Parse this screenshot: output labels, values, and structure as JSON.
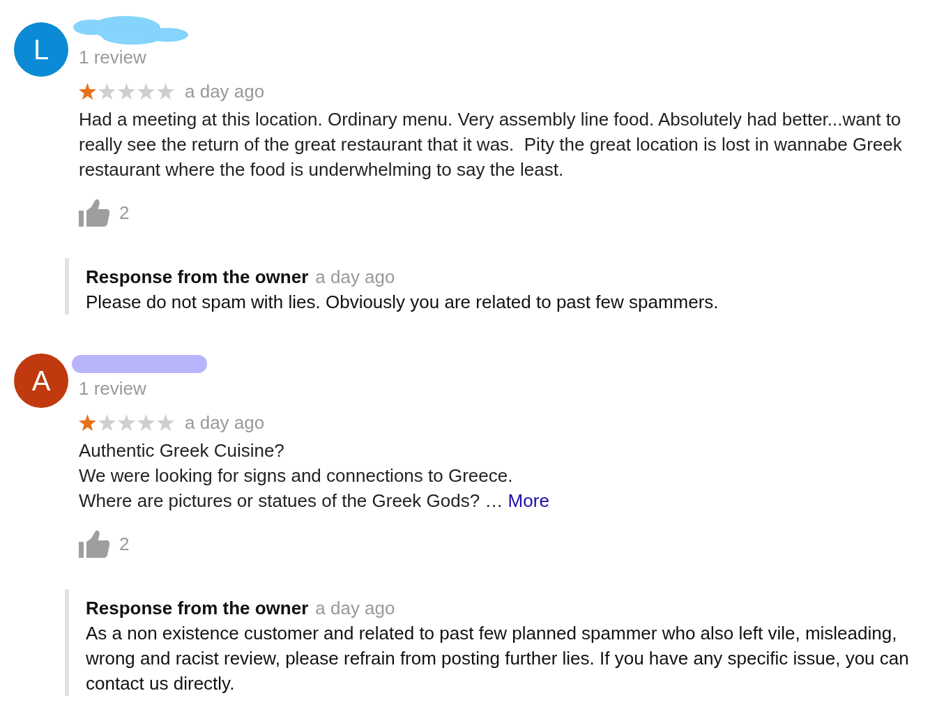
{
  "reviews": [
    {
      "avatar": {
        "letter": "L",
        "color": "#0b8ad6"
      },
      "redaction": {
        "kind": "cloud",
        "color": "#84d4fc"
      },
      "review_count": "1 review",
      "stars": 1,
      "time": "a day ago",
      "text": "Had a meeting at this location. Ordinary menu. Very assembly line food. Absolutely had better...want to really see the return of the great restaurant that it was.  Pity the great location is lost in wannabe Greek restaurant where the food is underwhelming to say the least.",
      "likes": "2",
      "owner_response": {
        "title": "Response from the owner",
        "time": "a day ago",
        "text": "Please do not spam with lies. Obviously you are related to past few spammers."
      }
    },
    {
      "avatar": {
        "letter": "A",
        "color": "#c0390f"
      },
      "redaction": {
        "kind": "stroke",
        "color": "#b8b4fc"
      },
      "review_count": "1 review",
      "stars": 1,
      "time": "a day ago",
      "text": "Authentic Greek Cuisine?\nWe were looking for signs and connections to Greece.\nWhere are pictures or statues of the Greek Gods? …",
      "more_link": "More",
      "likes": "2",
      "owner_response": {
        "title": "Response from the owner",
        "time": "a day ago",
        "text": "As a non existence customer and related to past few planned spammer who also left vile, misleading, wrong and racist review, please refrain from posting further lies. If you have any specific issue, you can contact us directly."
      }
    }
  ]
}
